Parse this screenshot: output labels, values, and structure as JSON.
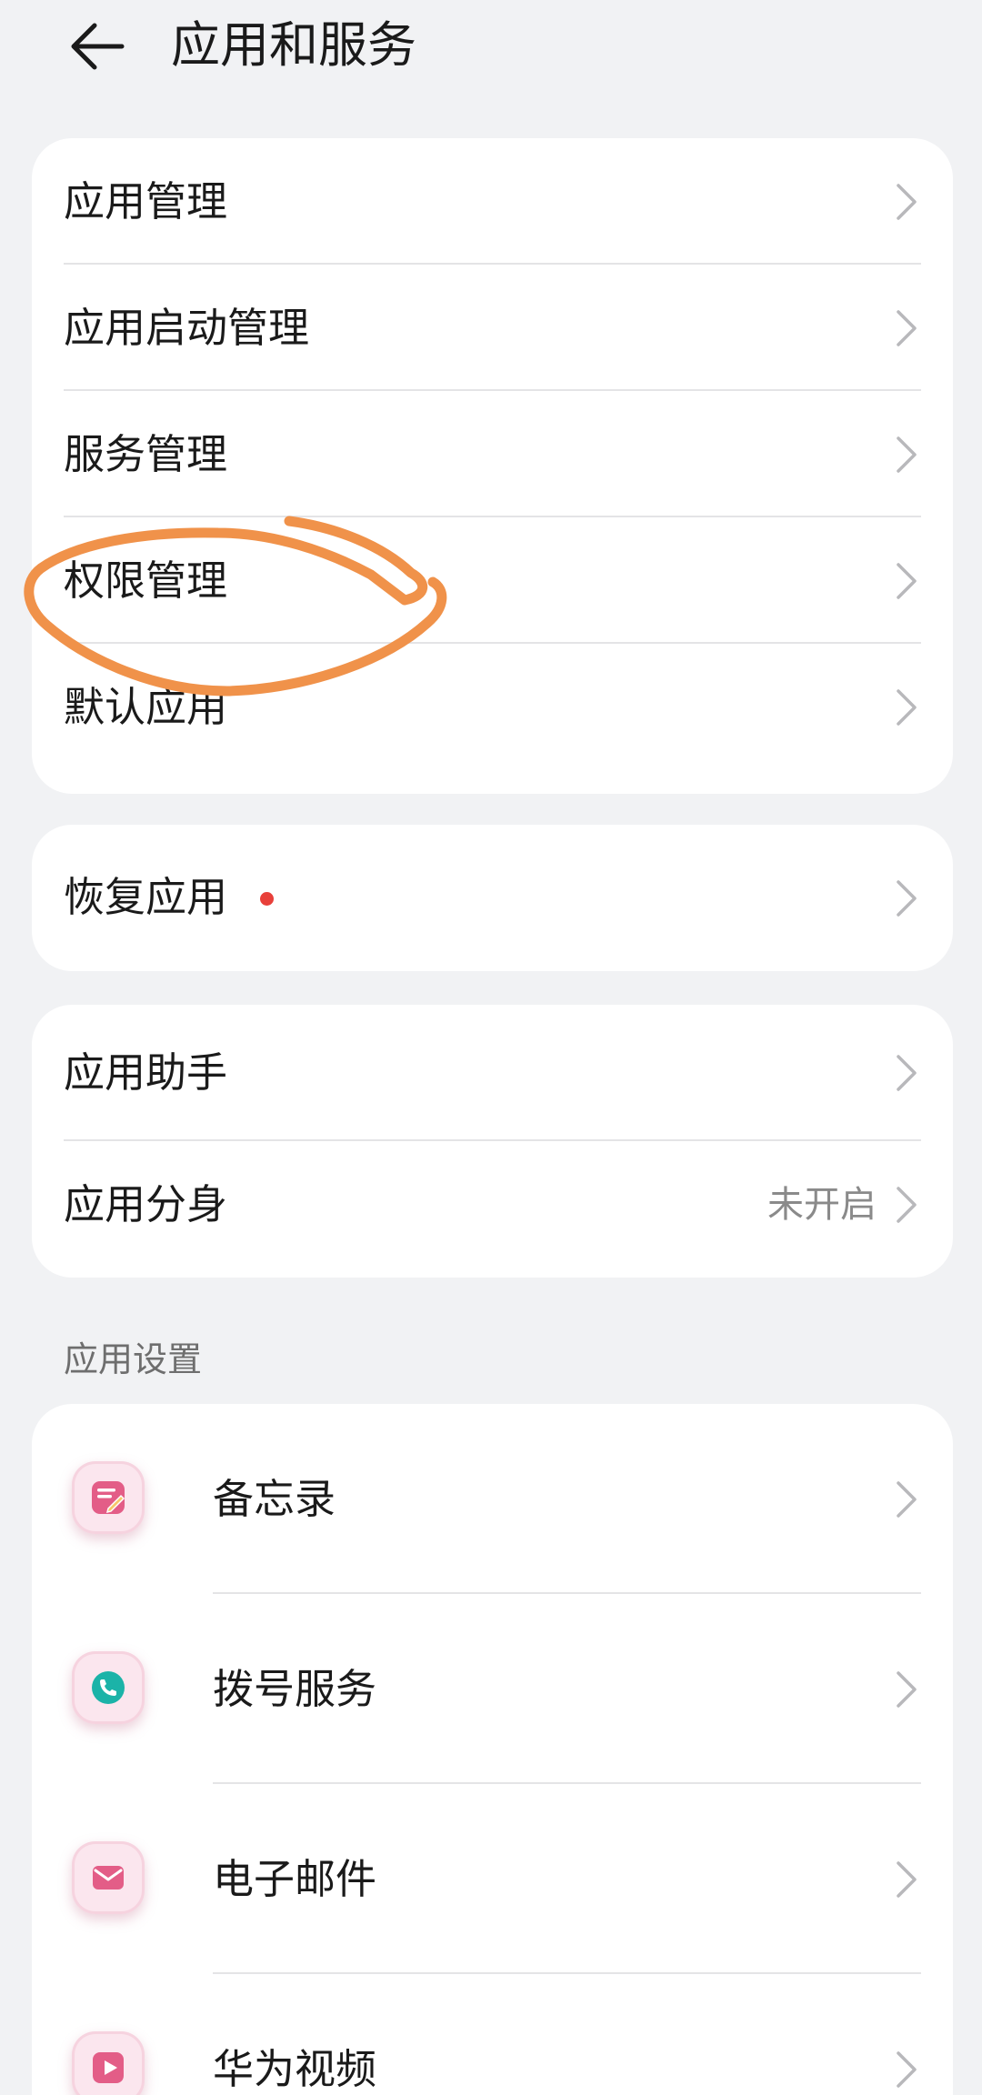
{
  "header": {
    "title": "应用和服务"
  },
  "group1": {
    "items": [
      {
        "label": "应用管理"
      },
      {
        "label": "应用启动管理"
      },
      {
        "label": "服务管理"
      },
      {
        "label": "权限管理"
      },
      {
        "label": "默认应用"
      }
    ]
  },
  "group2": {
    "items": [
      {
        "label": "恢复应用",
        "badge_color": "#e8403a"
      }
    ]
  },
  "group3": {
    "items": [
      {
        "label": "应用助手"
      },
      {
        "label": "应用分身",
        "value": "未开启"
      }
    ]
  },
  "app_settings": {
    "section_title": "应用设置",
    "items": [
      {
        "label": "备忘录",
        "icon": "notepad-icon"
      },
      {
        "label": "拨号服务",
        "icon": "phone-icon"
      },
      {
        "label": "电子邮件",
        "icon": "mail-icon"
      },
      {
        "label": "华为视频",
        "icon": "video-icon"
      }
    ]
  },
  "annotation": {
    "color": "#f0924a"
  }
}
